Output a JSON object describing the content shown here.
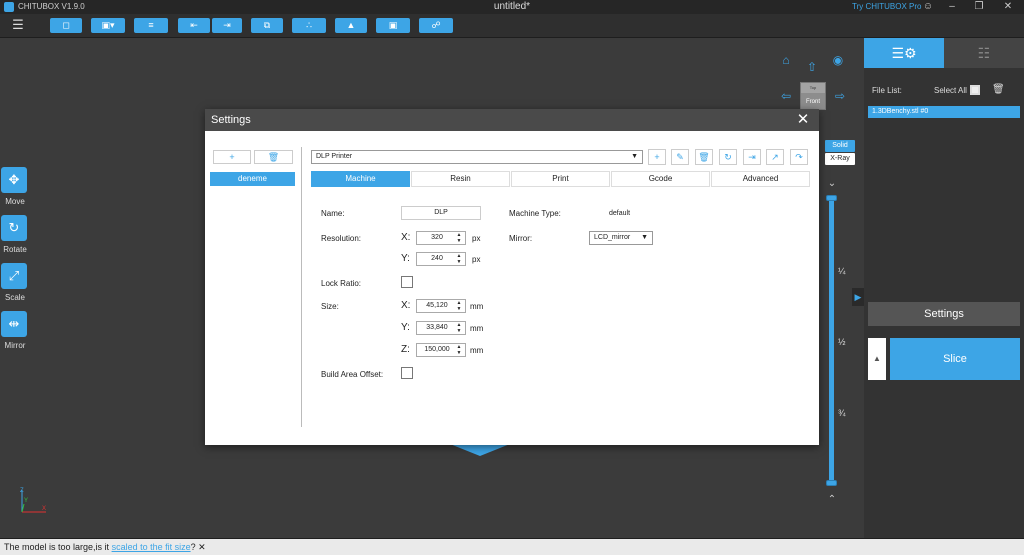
{
  "titlebar": {
    "app_title": "CHITUBOX V1.9.0",
    "doc_title": "untitled*",
    "try_pro": "Try CHITUBOX Pro",
    "user_icon": "user-icon",
    "minimize_icon": "minimize-icon",
    "maximize_icon": "maximize-icon",
    "close_icon": "close-icon"
  },
  "toolbar": {
    "menu_icon": "☰",
    "buttons": [
      "open-folder-icon",
      "save-icon",
      "layers-icon",
      "import-icon",
      "export-icon",
      "copy-icon",
      "nodes-icon",
      "support-icon",
      "hollow-icon",
      "lock-icon"
    ]
  },
  "left_tools": [
    {
      "label": "Move",
      "icon": "✥"
    },
    {
      "label": "Rotate",
      "icon": "↻"
    },
    {
      "label": "Scale",
      "icon": "⤢"
    },
    {
      "label": "Mirror",
      "icon": "⇹"
    }
  ],
  "view": {
    "cube_top": "Top",
    "cube_front": "Front",
    "solid": "Solid",
    "xray": "X-Ray",
    "ticks": [
      "¼",
      "½",
      "¾"
    ]
  },
  "right_panel": {
    "file_list_label": "File List:",
    "select_all_label": "Select All",
    "file_item": "1.3DBenchy.stl #0",
    "settings_label": "Settings",
    "slice_label": "Slice"
  },
  "status": {
    "message_before": "The model is too large,is it ",
    "link_text": "scaled to the fit size",
    "message_after": "?",
    "close_glyph": "✕"
  },
  "dialog": {
    "title": "Settings",
    "close_glyph": "✕",
    "profile_add": "+",
    "profile_delete": "🗑",
    "profiles": [
      "deneme"
    ],
    "printer_select": "DLP Printer",
    "tabs": [
      "Machine",
      "Resin",
      "Print",
      "Gcode",
      "Advanced"
    ],
    "machine": {
      "name_label": "Name:",
      "name_value": "DLP",
      "machine_type_label": "Machine Type:",
      "machine_type_value": "default",
      "resolution_label": "Resolution:",
      "res_x_label": "X:",
      "res_x_value": "320",
      "res_y_label": "Y:",
      "res_y_value": "240",
      "px_unit": "px",
      "mirror_label": "Mirror:",
      "mirror_value": "LCD_mirror",
      "lock_ratio_label": "Lock Ratio:",
      "size_label": "Size:",
      "size_x_label": "X:",
      "size_x_value": "45,120",
      "size_y_label": "Y:",
      "size_y_value": "33,840",
      "size_z_label": "Z:",
      "size_z_value": "150,000",
      "mm_unit": "mm",
      "build_offset_label": "Build Area Offset:"
    }
  },
  "colors": {
    "accent": "#3da5e6",
    "background": "#3b3b3b",
    "panel": "#333333"
  }
}
